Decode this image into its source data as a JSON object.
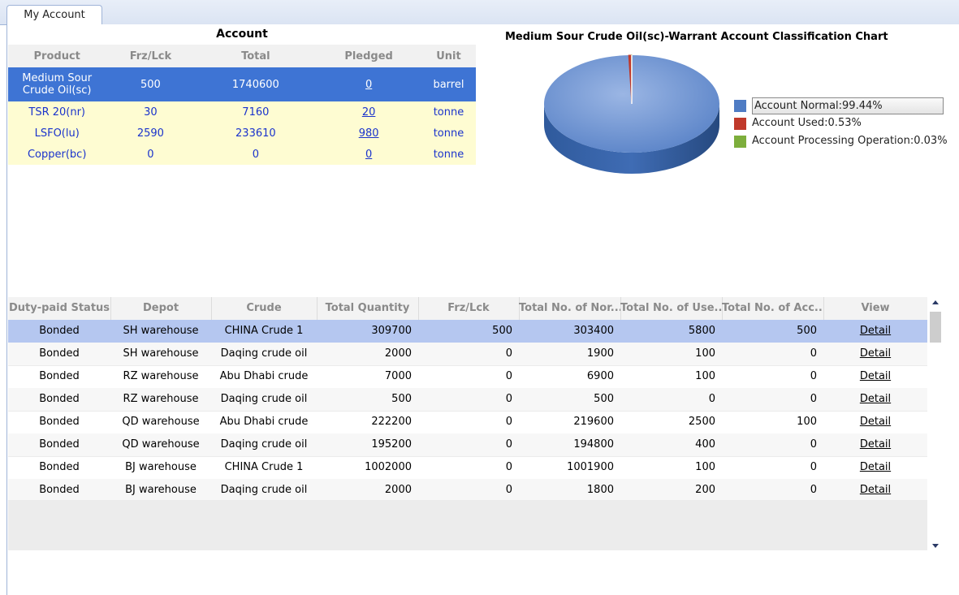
{
  "tab": {
    "label": "My Account"
  },
  "account": {
    "title": "Account",
    "columns": [
      "Product",
      "Frz/Lck",
      "Total",
      "Pledged",
      "Unit"
    ],
    "rows": [
      {
        "product": "Medium Sour Crude Oil(sc)",
        "frz": "500",
        "total": "1740600",
        "pledged": "0",
        "unit": "barrel"
      },
      {
        "product": "TSR 20(nr)",
        "frz": "30",
        "total": "7160",
        "pledged": "20",
        "unit": "tonne"
      },
      {
        "product": "LSFO(lu)",
        "frz": "2590",
        "total": "233610",
        "pledged": "980",
        "unit": "tonne"
      },
      {
        "product": "Copper(bc)",
        "frz": "0",
        "total": "0",
        "pledged": "0",
        "unit": "tonne"
      }
    ]
  },
  "chart_data": {
    "type": "pie",
    "title": "Medium Sour Crude Oil(sc)-Warrant Account Classification Chart",
    "slices": [
      {
        "label": "Account Normal:99.44%",
        "value": 99.44,
        "color": "#4f7cc4"
      },
      {
        "label": "Account Used:0.53%",
        "value": 0.53,
        "color": "#c0392b"
      },
      {
        "label": "Account Processing Operation:0.03%",
        "value": 0.03,
        "color": "#7dae3c"
      }
    ],
    "legend_position": "right"
  },
  "grid": {
    "columns": [
      "Duty-paid Status",
      "Depot",
      "Crude",
      "Total Quantity",
      "Frz/Lck",
      "Total No. of Nor...",
      "Total No. of Use...",
      "Total No. of Acc...",
      "View"
    ],
    "rows": [
      {
        "status": "Bonded",
        "depot": "SH warehouse",
        "crude": "CHINA Crude 1",
        "qty": "309700",
        "frz": "500",
        "normal": "303400",
        "used": "5800",
        "acc": "500",
        "view": "Detail"
      },
      {
        "status": "Bonded",
        "depot": "SH warehouse",
        "crude": "Daqing crude oil",
        "qty": "2000",
        "frz": "0",
        "normal": "1900",
        "used": "100",
        "acc": "0",
        "view": "Detail"
      },
      {
        "status": "Bonded",
        "depot": "RZ warehouse",
        "crude": "Abu Dhabi crude",
        "qty": "7000",
        "frz": "0",
        "normal": "6900",
        "used": "100",
        "acc": "0",
        "view": "Detail"
      },
      {
        "status": "Bonded",
        "depot": "RZ warehouse",
        "crude": "Daqing crude oil",
        "qty": "500",
        "frz": "0",
        "normal": "500",
        "used": "0",
        "acc": "0",
        "view": "Detail"
      },
      {
        "status": "Bonded",
        "depot": "QD warehouse",
        "crude": "Abu Dhabi crude",
        "qty": "222200",
        "frz": "0",
        "normal": "219600",
        "used": "2500",
        "acc": "100",
        "view": "Detail"
      },
      {
        "status": "Bonded",
        "depot": "QD warehouse",
        "crude": "Daqing crude oil",
        "qty": "195200",
        "frz": "0",
        "normal": "194800",
        "used": "400",
        "acc": "0",
        "view": "Detail"
      },
      {
        "status": "Bonded",
        "depot": "BJ warehouse",
        "crude": "CHINA Crude 1",
        "qty": "1002000",
        "frz": "0",
        "normal": "1001900",
        "used": "100",
        "acc": "0",
        "view": "Detail"
      },
      {
        "status": "Bonded",
        "depot": "BJ warehouse",
        "crude": "Daqing crude oil",
        "qty": "2000",
        "frz": "0",
        "normal": "1800",
        "used": "200",
        "acc": "0",
        "view": "Detail"
      }
    ]
  }
}
